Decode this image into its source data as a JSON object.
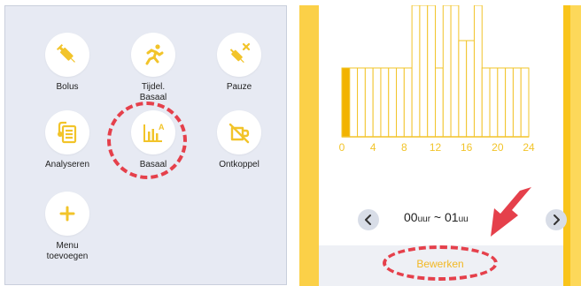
{
  "left_menu": {
    "items": [
      {
        "label": "Bolus",
        "icon": "syringe-icon"
      },
      {
        "label": "Tijdel. Basaal",
        "icon": "running-person-icon"
      },
      {
        "label": "Pauze",
        "icon": "syringe-x-icon"
      },
      {
        "label": "Analyseren",
        "icon": "clipboard-icon"
      },
      {
        "label": "Basaal",
        "icon": "basal-chart-icon"
      },
      {
        "label": "Ontkoppel",
        "icon": "disconnect-icon"
      },
      {
        "label": "Menu toevoegen",
        "icon": "plus-icon"
      }
    ]
  },
  "right_panel": {
    "time": {
      "start": "00",
      "start_unit": "uur",
      "separator": "~",
      "end": "01",
      "end_unit": "uu"
    },
    "edit_label": "Bewerken",
    "prev_icon": "chevron-left-icon",
    "next_icon": "chevron-right-icon"
  },
  "chart_data": {
    "type": "bar",
    "x_ticks": [
      "0",
      "4",
      "8",
      "12",
      "16",
      "20",
      "24"
    ],
    "xlim": [
      0,
      24
    ],
    "hours": [
      0,
      1,
      2,
      3,
      4,
      5,
      6,
      7,
      8,
      9,
      10,
      11,
      12,
      13,
      14,
      15,
      16,
      17,
      18,
      19,
      20,
      21,
      22,
      23
    ],
    "values": [
      1.0,
      1.0,
      1.0,
      1.0,
      1.0,
      1.0,
      1.0,
      1.0,
      1.0,
      1.9,
      1.9,
      1.9,
      1.0,
      1.9,
      1.9,
      1.6,
      1.6,
      1.9,
      1.0,
      1.0,
      1.0,
      1.0,
      1.0,
      1.0
    ],
    "selected_hour": 0,
    "bar_color": "#f2c42a",
    "selected_color": "#f2b300"
  },
  "colors": {
    "accent": "#f9c41a",
    "highlight": "#e5404b",
    "icon": "#f2c42a"
  }
}
